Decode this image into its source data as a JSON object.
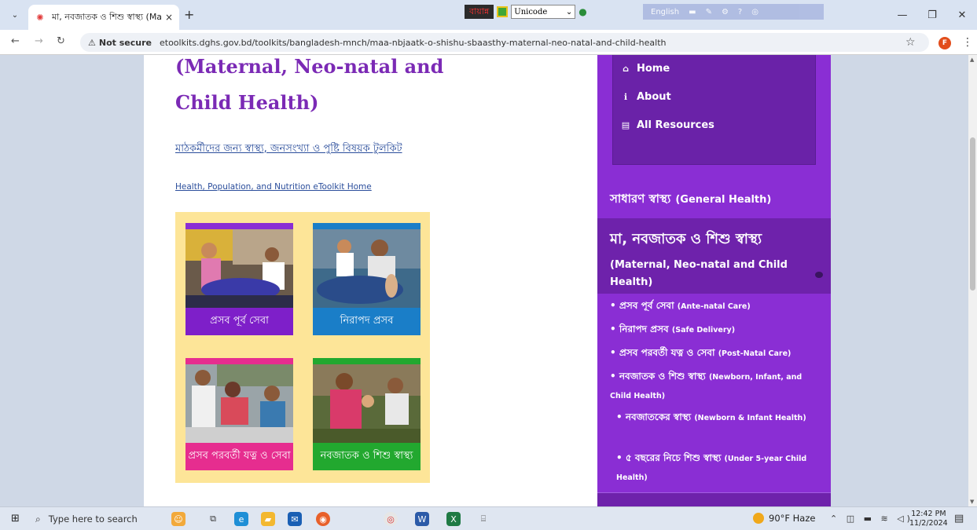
{
  "browser": {
    "tab_title": "মা, নবজাতক ও শিশু স্বাস্থ্য (Mate",
    "tab_close": "×",
    "new_tab": "+",
    "ime": {
      "bijoy_label": "বায়ান্ন",
      "font_select": "Unicode",
      "tools_label": "English"
    },
    "security_label": "Not secure",
    "url": "etoolkits.dghs.gov.bd/toolkits/bangladesh-mnch/maa-nbjaatk-o-shishu-sbaasthy-maternal-neo-natal-and-child-health",
    "profile_initial": "F",
    "window_controls": {
      "minimize": "—",
      "maximize": "❐",
      "close": "✕"
    }
  },
  "page": {
    "heading_line1": "(Maternal, Neo-natal and",
    "heading_line2": "Child Health)",
    "bangla_toolkit_link": "মাঠকর্মীদের জন্য স্বাস্থ্য, জনসংখ্যা ও পুষ্টি বিষয়ক টুলকিট",
    "home_link": "Health, Population, and Nutrition eToolkit Home",
    "tiles": [
      {
        "caption": "প্রসব পূর্ব সেবা",
        "color": "#7e1fc9"
      },
      {
        "caption": "নিরাপদ প্রসব",
        "color": "#1a7ec8"
      },
      {
        "caption": "প্রসব পরবর্তী যত্ন ও সেবা",
        "color": "#e62d8f"
      },
      {
        "caption": "নবজাতক ও শিশু স্বাস্থ্য",
        "color": "#22a82f"
      }
    ]
  },
  "sidebar": {
    "menu": [
      {
        "label": "Home",
        "icon": "home-icon"
      },
      {
        "label": "About",
        "icon": "info-icon"
      },
      {
        "label": "All Resources",
        "icon": "resources-icon"
      }
    ],
    "general_health": {
      "bn": "সাধারণ স্বাস্থ্য",
      "en": "(General Health)"
    },
    "mnch": {
      "bn": "মা, নবজাতক ও শিশু স্বাস্থ্য",
      "en": "(Maternal, Neo-natal and Child Health)"
    },
    "sub_items": [
      {
        "bn": "প্রসব পূর্ব সেবা",
        "en": "(Ante-natal Care)"
      },
      {
        "bn": "নিরাপদ প্রসব",
        "en": "(Safe Delivery)"
      },
      {
        "bn": "প্রসব পরবর্তী যত্ন ও সেবা",
        "en": "(Post-Natal Care)"
      },
      {
        "bn": "নবজাতক ও শিশু স্বাস্থ্য",
        "en": "(Newborn, Infant, and Child Health)"
      },
      {
        "bn": "নবজাতকের স্বাস্থ্য",
        "en": "(Newborn & Infant Health)"
      },
      {
        "bn": "৫ বছরের নিচে শিশু স্বাস্থ্য",
        "en": "(Under 5-year Child Health)"
      }
    ],
    "accent": "#8a2ed4"
  },
  "taskbar": {
    "search_placeholder": "Type here to search",
    "weather": "90°F  Haze",
    "time": "12:42 PM",
    "date": "11/2/2024"
  }
}
